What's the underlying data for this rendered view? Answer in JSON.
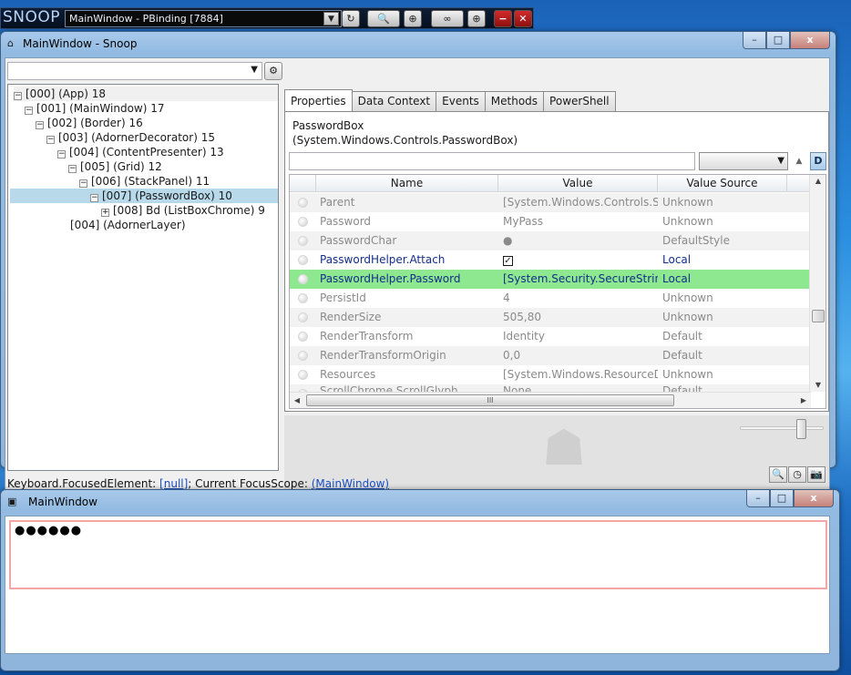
{
  "snoop_bar": {
    "logo": "SNOOP",
    "window_selector": "MainWindow - PBinding [7884]"
  },
  "snoop_window": {
    "title": "MainWindow - Snoop",
    "caption_min": "–",
    "caption_max": "□",
    "caption_close": "x",
    "tree": [
      {
        "label": "[000]  (App) 18",
        "toggle": "−"
      },
      {
        "label": "[001]  (MainWindow) 17",
        "toggle": "−"
      },
      {
        "label": "[002]  (Border) 16",
        "toggle": "−"
      },
      {
        "label": "[003]  (AdornerDecorator) 15",
        "toggle": "−"
      },
      {
        "label": "[004]  (ContentPresenter) 13",
        "toggle": "−"
      },
      {
        "label": "[005]  (Grid) 12",
        "toggle": "−"
      },
      {
        "label": "[006]  (StackPanel) 11",
        "toggle": "−"
      },
      {
        "label": "[007]  (PasswordBox) 10",
        "toggle": "−"
      },
      {
        "label": "[008] Bd (ListBoxChrome) 9",
        "toggle": "+"
      },
      {
        "label": "[004]  (AdornerLayer)",
        "toggle": ""
      }
    ],
    "tabs": [
      "Properties",
      "Data Context",
      "Events",
      "Methods",
      "PowerShell"
    ],
    "selected_type": {
      "name": "PasswordBox",
      "full": "(System.Windows.Controls.PasswordBox)"
    },
    "filter_buttons": {
      "up": "▲",
      "d": "D"
    },
    "grid_headers": {
      "name": "Name",
      "value": "Value",
      "source": "Value Source"
    },
    "grid_rows": [
      {
        "name": "Parent",
        "value": "[System.Windows.Controls.StackPanel]",
        "source": "Unknown"
      },
      {
        "name": "Password",
        "value": "MyPass",
        "source": "Unknown"
      },
      {
        "name": "PasswordChar",
        "value": "●",
        "source": "DefaultStyle"
      },
      {
        "name": "PasswordHelper.Attach",
        "value": "✓",
        "source": "Local"
      },
      {
        "name": "PasswordHelper.Password",
        "value": "[System.Security.SecureString]",
        "source": "Local"
      },
      {
        "name": "PersistId",
        "value": "4",
        "source": "Unknown"
      },
      {
        "name": "RenderSize",
        "value": "505,80",
        "source": "Unknown"
      },
      {
        "name": "RenderTransform",
        "value": "Identity",
        "source": "Default"
      },
      {
        "name": "RenderTransformOrigin",
        "value": "0,0",
        "source": "Default"
      },
      {
        "name": "Resources",
        "value": "[System.Windows.ResourceDictionary]",
        "source": "Unknown"
      },
      {
        "name": "ScrollChrome.ScrollGlyph",
        "value": "None",
        "source": "Default"
      }
    ],
    "hscroll_grip": "III",
    "status": {
      "prefix": "Keyboard.FocusedElement: ",
      "focused": "[null]",
      "middle": "; Current FocusScope: ",
      "scope": "(MainWindow)"
    }
  },
  "main_window": {
    "title": "MainWindow",
    "password_mask": "●●●●●●"
  },
  "colors": {
    "highlight_row": "#8ee88f",
    "selected_tree": "#b7d9ea",
    "local_text": "#132e8a"
  }
}
